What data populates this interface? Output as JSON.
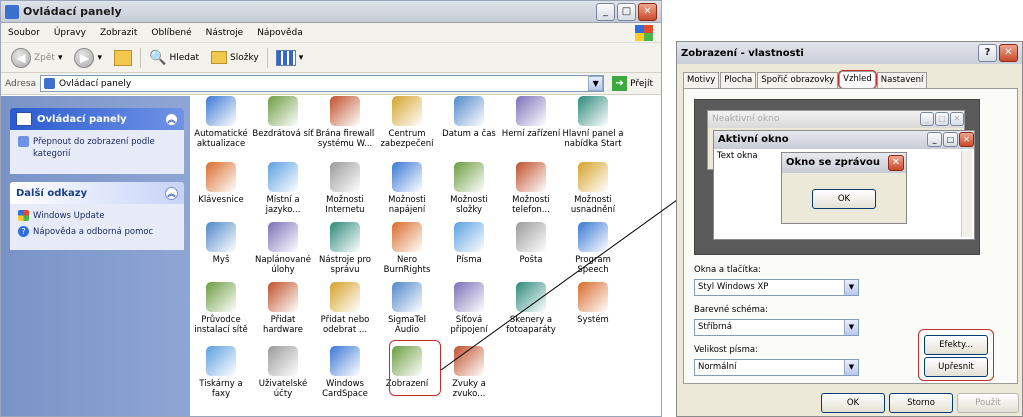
{
  "control_panel": {
    "title": "Ovládací panely",
    "window_buttons": {
      "minimize": "_",
      "maximize": "□",
      "close": "✕"
    },
    "menu": [
      "Soubor",
      "Úpravy",
      "Zobrazit",
      "Oblíbené",
      "Nástroje",
      "Nápověda"
    ],
    "toolbar": {
      "back": "Zpět",
      "search": "Hledat",
      "folders": "Složky"
    },
    "address": {
      "label": "Adresa",
      "value": "Ovládací panely",
      "go": "Přejít"
    },
    "sidebar": {
      "panel1_title": "Ovládací panely",
      "panel1_link": "Přepnout do zobrazení podle kategorií",
      "panel2_title": "Další odkazy",
      "links": [
        "Windows Update",
        "Nápověda a odborná pomoc"
      ]
    },
    "icons": [
      "Automatické aktualizace",
      "Bezdrátová síť",
      "Brána firewall systému W...",
      "Centrum zabezpečení",
      "Datum a čas",
      "Herní zařízení",
      "Hlavní panel a nabídka Start",
      "Klávesnice",
      "Místní a jazyko...",
      "Možnosti Internetu",
      "Možnosti napájení",
      "Možnosti složky",
      "Možnosti telefon...",
      "Možnosti usnadnění",
      "Myš",
      "Naplánované úlohy",
      "Nástroje pro správu",
      "Nero BurnRights",
      "Písma",
      "Pošta",
      "Program Speech",
      "Průvodce instalací sítě",
      "Přidat hardware",
      "Přidat nebo odebrat ...",
      "SigmaTel Audio",
      "Síťová připojení",
      "Skenery a fotoaparáty",
      "Systém",
      "Tiskárny a faxy",
      "Uživatelské účty",
      "Windows CardSpace",
      "Zobrazení",
      "Zvuky a zvuko..."
    ]
  },
  "dialog": {
    "title": "Zobrazení - vlastnosti",
    "help": "?",
    "close": "✕",
    "tabs": [
      "Motivy",
      "Plocha",
      "Spořič obrazovky",
      "Vzhled",
      "Nastavení"
    ],
    "preview": {
      "inactive": "Neaktivní okno",
      "active": "Aktivní okno",
      "text": "Text okna",
      "msgbox": "Okno se zprávou",
      "ok": "OK"
    },
    "windows_buttons_label": "Okna a tlačítka:",
    "windows_buttons_value": "Styl Windows XP",
    "scheme_label": "Barevné schéma:",
    "scheme_value": "Stříbrná",
    "font_label": "Velikost písma:",
    "font_value": "Normální",
    "effects": "Efekty...",
    "advanced": "Upřesnit",
    "ok": "OK",
    "cancel": "Storno",
    "apply": "Použít"
  },
  "colors": {
    "accent_red": "#c32d2d",
    "xp_blue": "#2b5bcf"
  }
}
